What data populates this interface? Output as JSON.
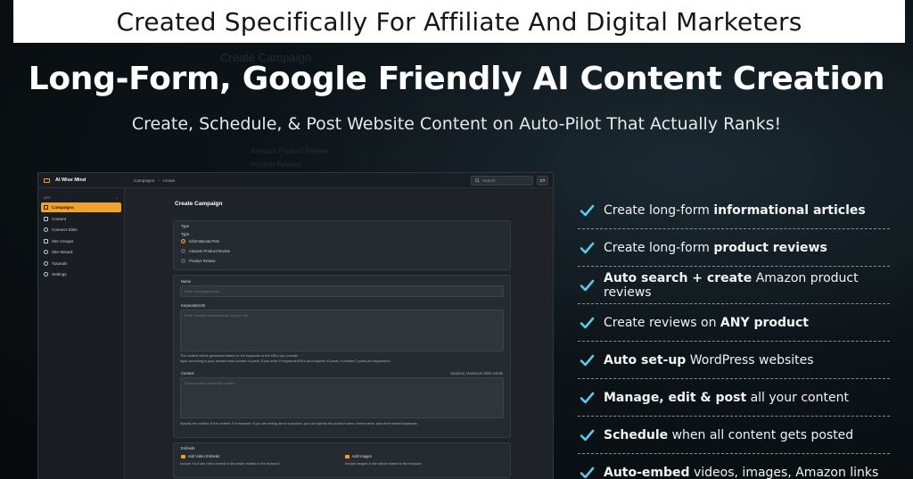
{
  "colors": {
    "accent": "#f0a22e",
    "check": "#5bc8ee",
    "banner_bg": "#ffffff"
  },
  "banner": {
    "text": "Created Specifically For Affiliate And Digital Marketers"
  },
  "headline": "Long-Form, Google Friendly AI Content Creation",
  "subhead": "Create, Schedule, & Post Website Content on Auto-Pilot That Actually Ranks!",
  "background_ghost": {
    "title": "Create Campaign",
    "line1": "Amazon Product Review",
    "line2": "Product Review"
  },
  "app": {
    "brand": "AI Wise Mind",
    "breadcrumb": [
      "Campaigns",
      "/",
      "Create"
    ],
    "search_placeholder": "Search",
    "avatar_initials": "CT",
    "sidebar": {
      "heading": "APP",
      "items": [
        {
          "label": "Campaigns",
          "icon": "list-icon",
          "active": true
        },
        {
          "label": "Content",
          "icon": "document-icon"
        },
        {
          "label": "Connect Sites",
          "icon": "globe-icon"
        },
        {
          "label": "Site Groups",
          "icon": "folder-icon"
        },
        {
          "label": "Site Wizard",
          "icon": "wand-icon"
        },
        {
          "label": "Tutorials",
          "icon": "lightbulb-icon"
        },
        {
          "label": "Settings",
          "icon": "gear-icon"
        }
      ]
    },
    "page_title": "Create Campaign",
    "type_card": {
      "section_label": "Type",
      "field_label": "Type",
      "options": [
        "Informational Post",
        "Amazon Product Review",
        "Product Review"
      ],
      "selected": "Informational Post"
    },
    "details_card": {
      "name_label": "Name",
      "name_placeholder": "Enter campaign name",
      "keywords_label": "Keywords/Urls",
      "keywords_placeholder": "Enter multiple keywords/urls one per line",
      "keywords_help_1": "The content will be generated based on the keywords or the URLs you provide.",
      "keywords_help_2": "Input according to your desired total number of posts. If you enter 5 Keywords/URLs and request 10 posts, it creates 2 posts per keyword/url.",
      "context_label": "Context",
      "context_limit": "Optional, Maximum 3000 words",
      "context_placeholder": "Some context about the content",
      "context_help": "Specify the context of the content. For example, if you are writing about a product, you can specify the product name, brand name, and other related keywords."
    },
    "embeds_card": {
      "section_label": "Embeds",
      "video_label": "Add Video Embeds",
      "video_help": "Include YouTube video embed in the article related to the keyword.",
      "images_label": "Add Images",
      "images_help": "Include images in the article related to the keyword."
    }
  },
  "features": [
    {
      "pre": "Create long-form ",
      "bold": "informational articles",
      "post": ""
    },
    {
      "pre": "Create long-form ",
      "bold": "product reviews",
      "post": ""
    },
    {
      "pre": "",
      "bold": "Auto search + create",
      "post": " Amazon product reviews"
    },
    {
      "pre": "Create reviews on ",
      "bold": "ANY product",
      "post": ""
    },
    {
      "pre": "",
      "bold": "Auto set-up",
      "post": " WordPress websites"
    },
    {
      "pre": "",
      "bold": "Manage, edit & post",
      "post": " all your content"
    },
    {
      "pre": "",
      "bold": "Schedule",
      "post": " when all content gets posted"
    },
    {
      "pre": "",
      "bold": "Auto-embed",
      "post": " videos, images, Amazon links"
    }
  ]
}
